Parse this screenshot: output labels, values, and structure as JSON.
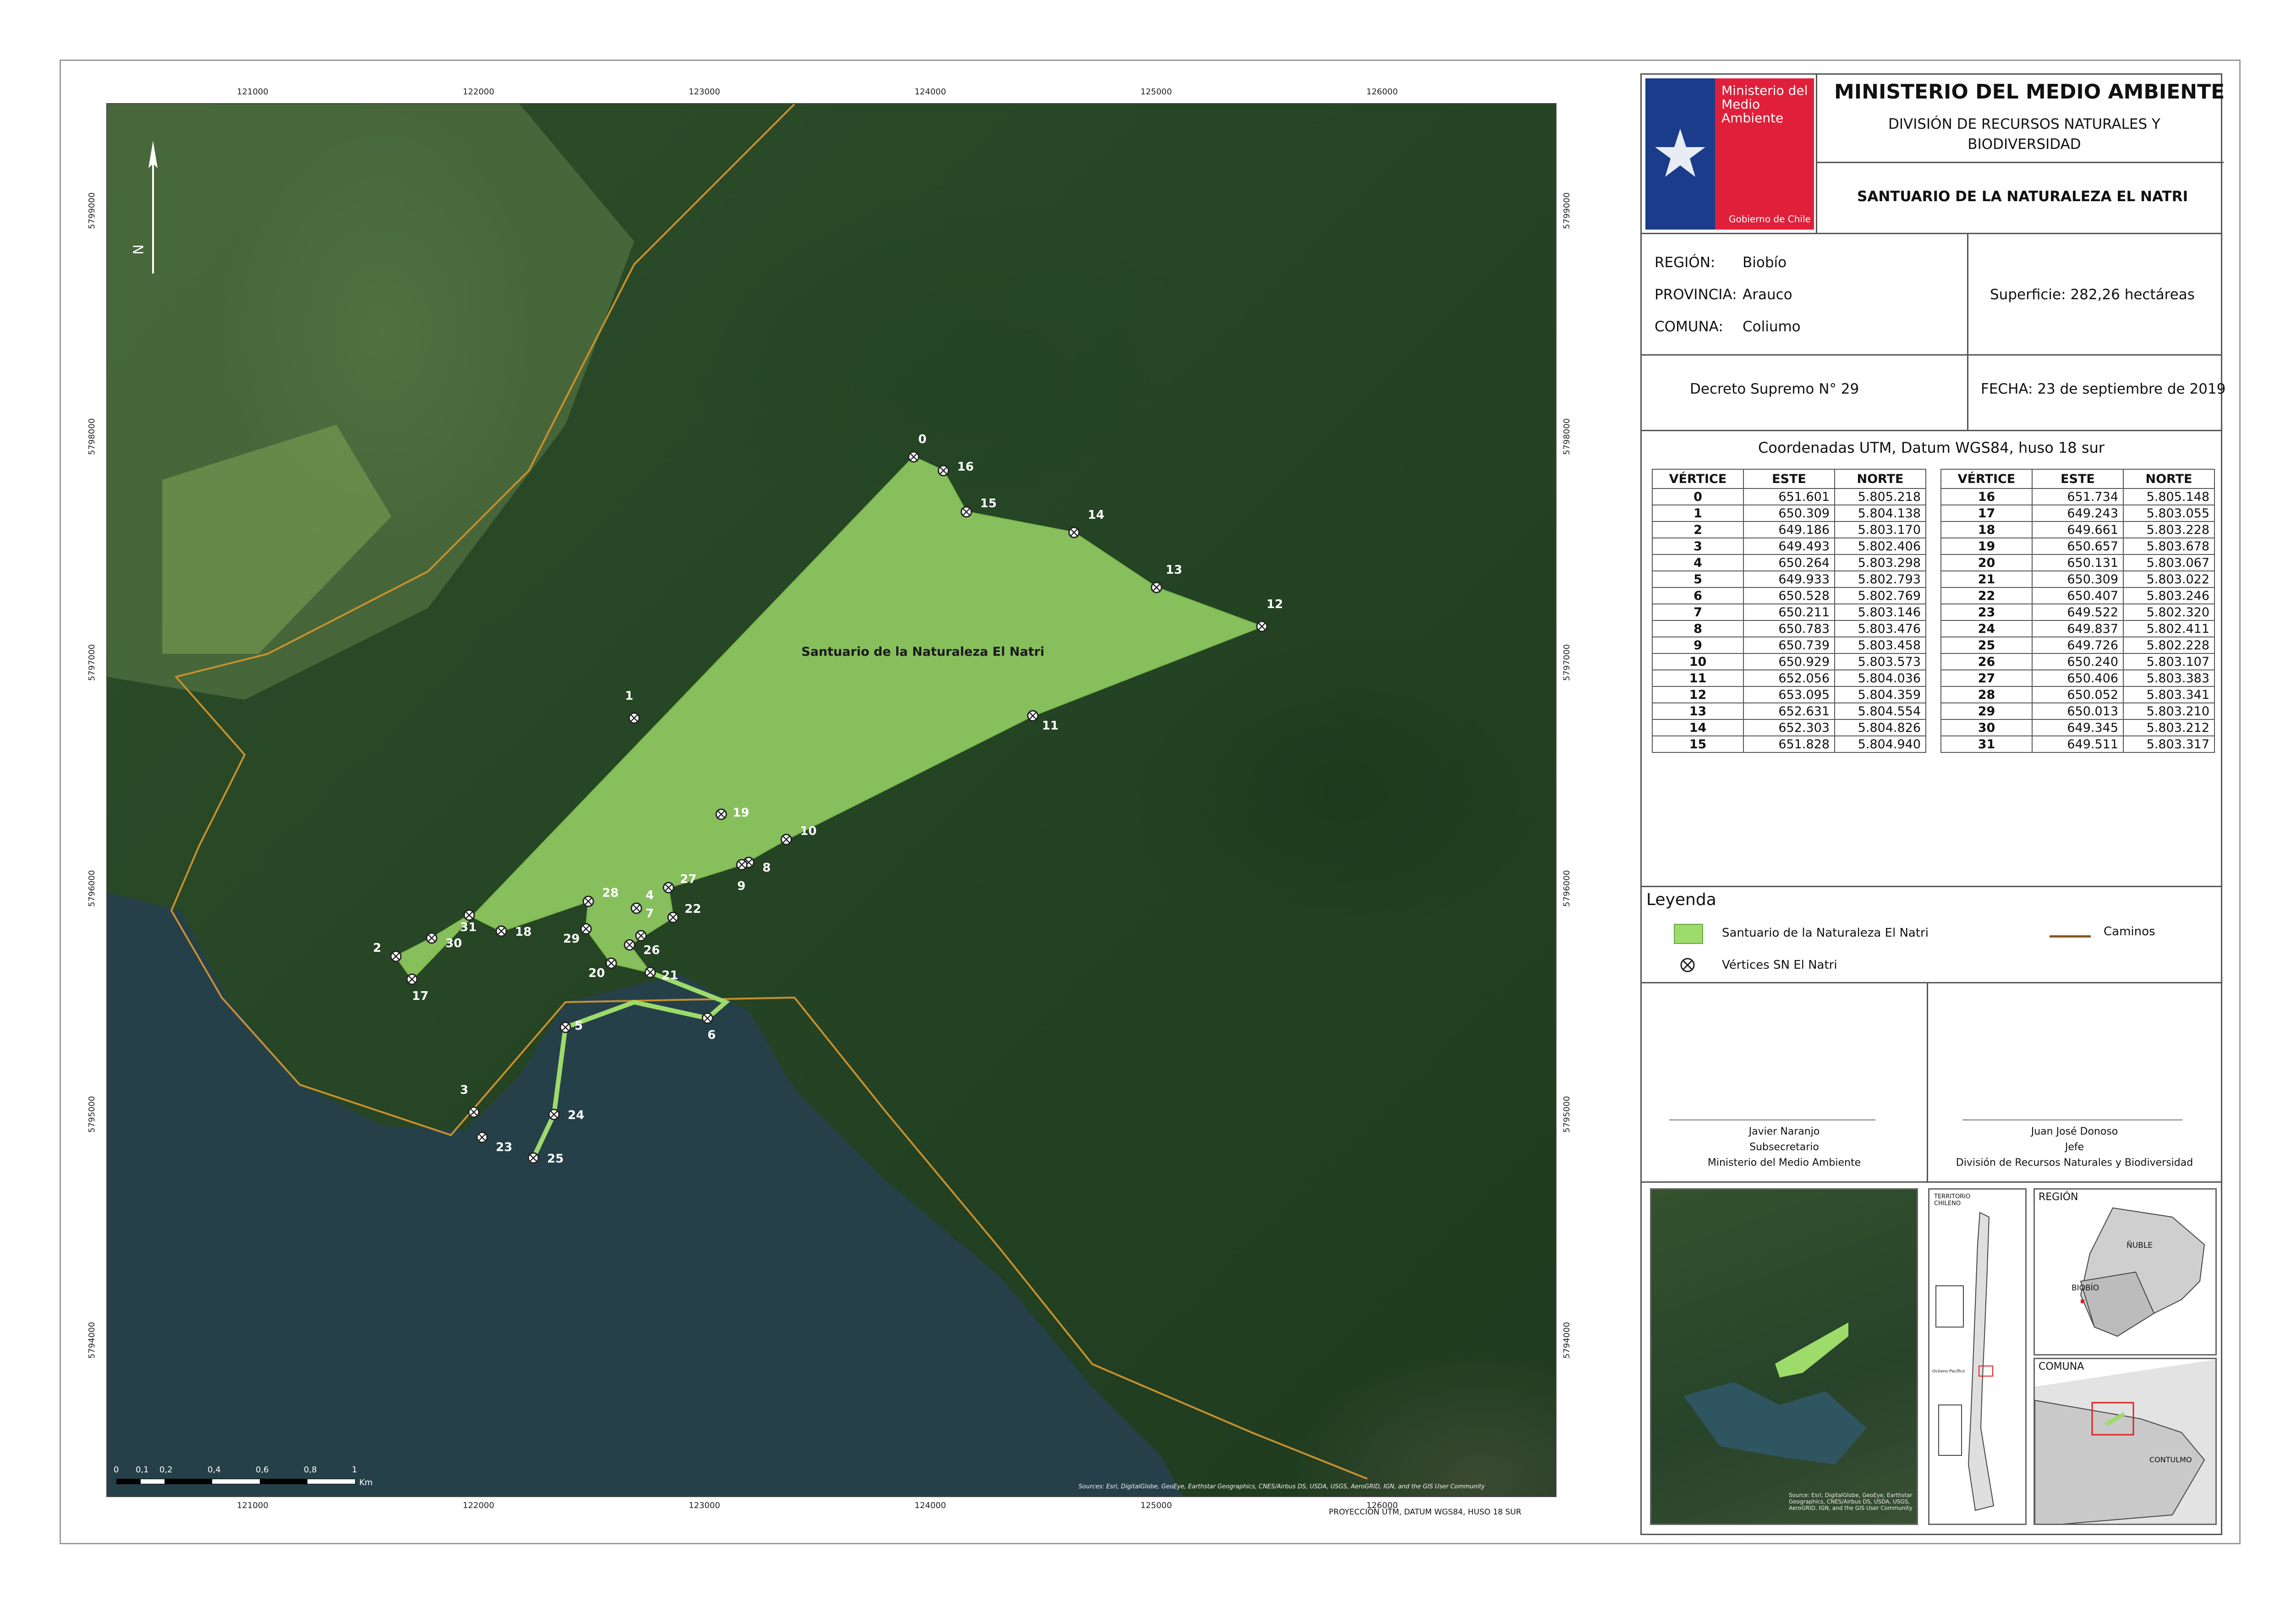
{
  "map": {
    "feature_label": "Santuario de la Naturaleza El Natri",
    "projection_note": "PROYECCIÓN UTM, DATUM WGS84, HUSO 18 SUR",
    "credits": "Sources: Esri, DigitalGlobe, GeoEye, Earthstar Geographics, CNES/Airbus DS, USDA, USGS, AeroGRID, IGN, and the GIS User Community",
    "north_label": "N",
    "x_ticks": [
      "121000",
      "122000",
      "123000",
      "124000",
      "125000",
      "126000"
    ],
    "y_ticks": [
      "5799000",
      "5798000",
      "5797000",
      "5796000",
      "5795000",
      "5794000"
    ],
    "scale_labels": [
      "0",
      "0,1",
      "0,2",
      "0,4",
      "0,6",
      "0,8",
      "1"
    ],
    "scale_unit": "Km",
    "vertex_labels": [
      "0",
      "1",
      "2",
      "3",
      "4",
      "5",
      "6",
      "7",
      "8",
      "9",
      "10",
      "11",
      "12",
      "13",
      "14",
      "15",
      "16",
      "17",
      "18",
      "19",
      "20",
      "21",
      "22",
      "23",
      "24",
      "25",
      "26",
      "27",
      "28",
      "29",
      "30",
      "31"
    ],
    "colors": {
      "polygon": "#9ddb6a",
      "water": "#26404a",
      "road": "#c8902e"
    }
  },
  "header": {
    "org_name": "Ministerio del Medio Ambiente",
    "gov_label": "Gobierno de Chile",
    "ministry": "MINISTERIO DEL MEDIO AMBIENTE",
    "division": "DIVISIÓN DE RECURSOS NATURALES Y BIODIVERSIDAD",
    "title": "SANTUARIO DE LA NATURALEZA EL NATRI"
  },
  "info": {
    "region_label": "REGIÓN:",
    "region_value": "Biobío",
    "provincia_label": "PROVINCIA:",
    "provincia_value": "Arauco",
    "comuna_label": "COMUNA:",
    "comuna_value": "Coliumo",
    "superficie": "Superficie: 282,26  hectáreas",
    "decreto": "Decreto Supremo N° 29",
    "fecha": "FECHA: 23 de septiembre de 2019"
  },
  "coords": {
    "title": "Coordenadas UTM, Datum WGS84, huso 18 sur",
    "headers": [
      "VÉRTICE",
      "ESTE",
      "NORTE"
    ],
    "left": [
      [
        "0",
        "651.601",
        "5.805.218"
      ],
      [
        "1",
        "650.309",
        "5.804.138"
      ],
      [
        "2",
        "649.186",
        "5.803.170"
      ],
      [
        "3",
        "649.493",
        "5.802.406"
      ],
      [
        "4",
        "650.264",
        "5.803.298"
      ],
      [
        "5",
        "649.933",
        "5.802.793"
      ],
      [
        "6",
        "650.528",
        "5.802.769"
      ],
      [
        "7",
        "650.211",
        "5.803.146"
      ],
      [
        "8",
        "650.783",
        "5.803.476"
      ],
      [
        "9",
        "650.739",
        "5.803.458"
      ],
      [
        "10",
        "650.929",
        "5.803.573"
      ],
      [
        "11",
        "652.056",
        "5.804.036"
      ],
      [
        "12",
        "653.095",
        "5.804.359"
      ],
      [
        "13",
        "652.631",
        "5.804.554"
      ],
      [
        "14",
        "652.303",
        "5.804.826"
      ],
      [
        "15",
        "651.828",
        "5.804.940"
      ]
    ],
    "right": [
      [
        "16",
        "651.734",
        "5.805.148"
      ],
      [
        "17",
        "649.243",
        "5.803.055"
      ],
      [
        "18",
        "649.661",
        "5.803.228"
      ],
      [
        "19",
        "650.657",
        "5.803.678"
      ],
      [
        "20",
        "650.131",
        "5.803.067"
      ],
      [
        "21",
        "650.309",
        "5.803.022"
      ],
      [
        "22",
        "650.407",
        "5.803.246"
      ],
      [
        "23",
        "649.522",
        "5.802.320"
      ],
      [
        "24",
        "649.837",
        "5.802.411"
      ],
      [
        "25",
        "649.726",
        "5.802.228"
      ],
      [
        "26",
        "650.240",
        "5.803.107"
      ],
      [
        "27",
        "650.406",
        "5.803.383"
      ],
      [
        "28",
        "650.052",
        "5.803.341"
      ],
      [
        "29",
        "650.013",
        "5.803.210"
      ],
      [
        "30",
        "649.345",
        "5.803.212"
      ],
      [
        "31",
        "649.511",
        "5.803.317"
      ]
    ]
  },
  "legend": {
    "title": "Leyenda",
    "polygon_label": "Santuario de la Naturaleza El Natri",
    "vertex_label": "Vértices SN El Natri",
    "road_label": "Caminos"
  },
  "signatures": {
    "left_name": "Javier Naranjo",
    "left_role": "Subsecretario",
    "left_org": "Ministerio del Medio Ambiente",
    "right_name": "Juan José Donoso",
    "right_role": "Jefe",
    "right_org": "División de Recursos Naturales y Biodiversidad"
  },
  "insets": {
    "territorio": "TERRITORIO CHILENO",
    "ocean": "Océano Pacífico",
    "region_title": "REGIÓN",
    "nuble": "ÑUBLE",
    "biobio": "BIOBÍO",
    "comuna_title": "COMUNA",
    "contulmo": "CONTULMO",
    "inset_credits": "Source: Esri, DigitalGlobe, GeoEye, Earthstar Geographics, CNES/Airbus DS, USDA, USGS, AeroGRID, IGN, and the GIS User Community"
  }
}
